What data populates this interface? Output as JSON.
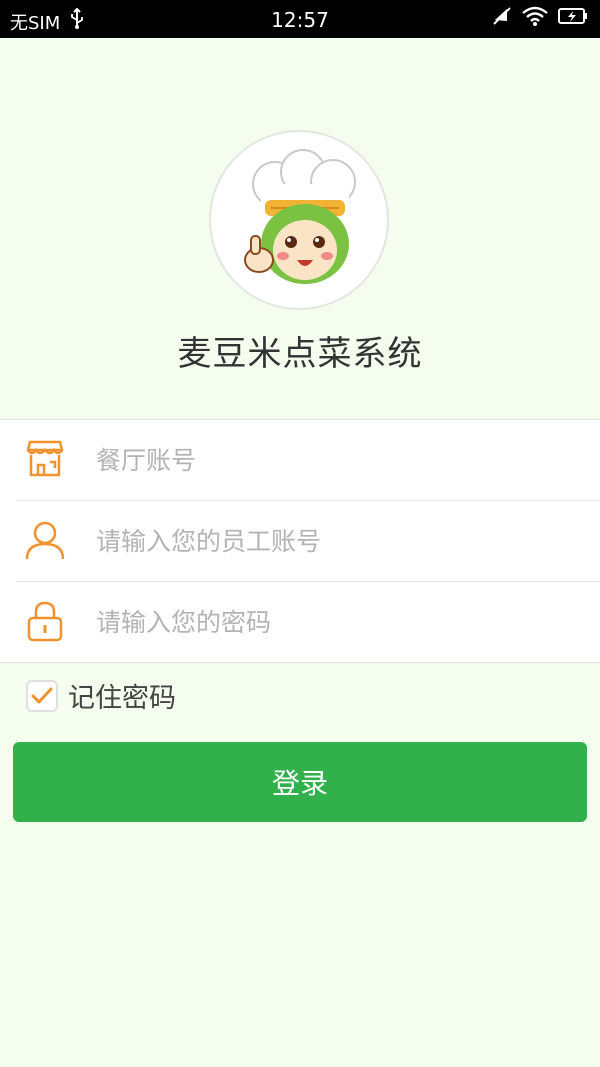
{
  "status_bar": {
    "carrier": "无SIM",
    "time": "12:57"
  },
  "app": {
    "title": "麦豆米点菜系统"
  },
  "form": {
    "restaurant_placeholder": "餐厅账号",
    "employee_placeholder": "请输入您的员工账号",
    "password_placeholder": "请输入您的密码"
  },
  "remember": {
    "label": "记住密码",
    "checked": true
  },
  "login": {
    "label": "登录"
  },
  "colors": {
    "accent_orange": "#f0922e",
    "primary_green": "#31b04b",
    "background": "#f4fdee"
  },
  "icons": [
    "usb-icon",
    "no-notifications-icon",
    "wifi-icon",
    "battery-charging-icon",
    "store-icon",
    "user-icon",
    "lock-icon",
    "check-icon"
  ]
}
